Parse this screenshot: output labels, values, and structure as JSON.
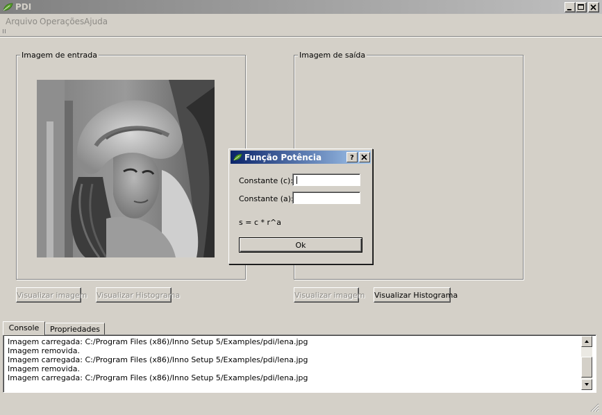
{
  "window": {
    "title": "PDI",
    "accent_color": "#0a246a"
  },
  "menu": {
    "items": [
      "Arquivo",
      "Operações",
      "Ajuda"
    ]
  },
  "input_panel": {
    "group_label": "Imagem de entrada",
    "view_image_button": "Visualizar imagem",
    "view_histogram_button": "Visualizar Histograma"
  },
  "output_panel": {
    "group_label": "Imagem de saída",
    "view_image_button": "Visualizar imagem",
    "view_histogram_button": "Visualizar Histograma"
  },
  "tabs": [
    {
      "label": "Console",
      "active": true
    },
    {
      "label": "Propriedades",
      "active": false
    }
  ],
  "console": {
    "lines": [
      "Imagem carregada: C:/Program Files (x86)/Inno Setup 5/Examples/pdi/lena.jpg",
      "Imagem removida.",
      "Imagem carregada: C:/Program Files (x86)/Inno Setup 5/Examples/pdi/lena.jpg",
      "Imagem removida.",
      "Imagem carregada: C:/Program Files (x86)/Inno Setup 5/Examples/pdi/lena.jpg"
    ]
  },
  "dialog": {
    "title": "Função Potência",
    "const_c_label": "Constante (c):",
    "const_c_value": "",
    "const_a_label": "Constante (a):",
    "const_a_value": "",
    "formula": "s = c * r^a",
    "ok_label": "Ok"
  }
}
